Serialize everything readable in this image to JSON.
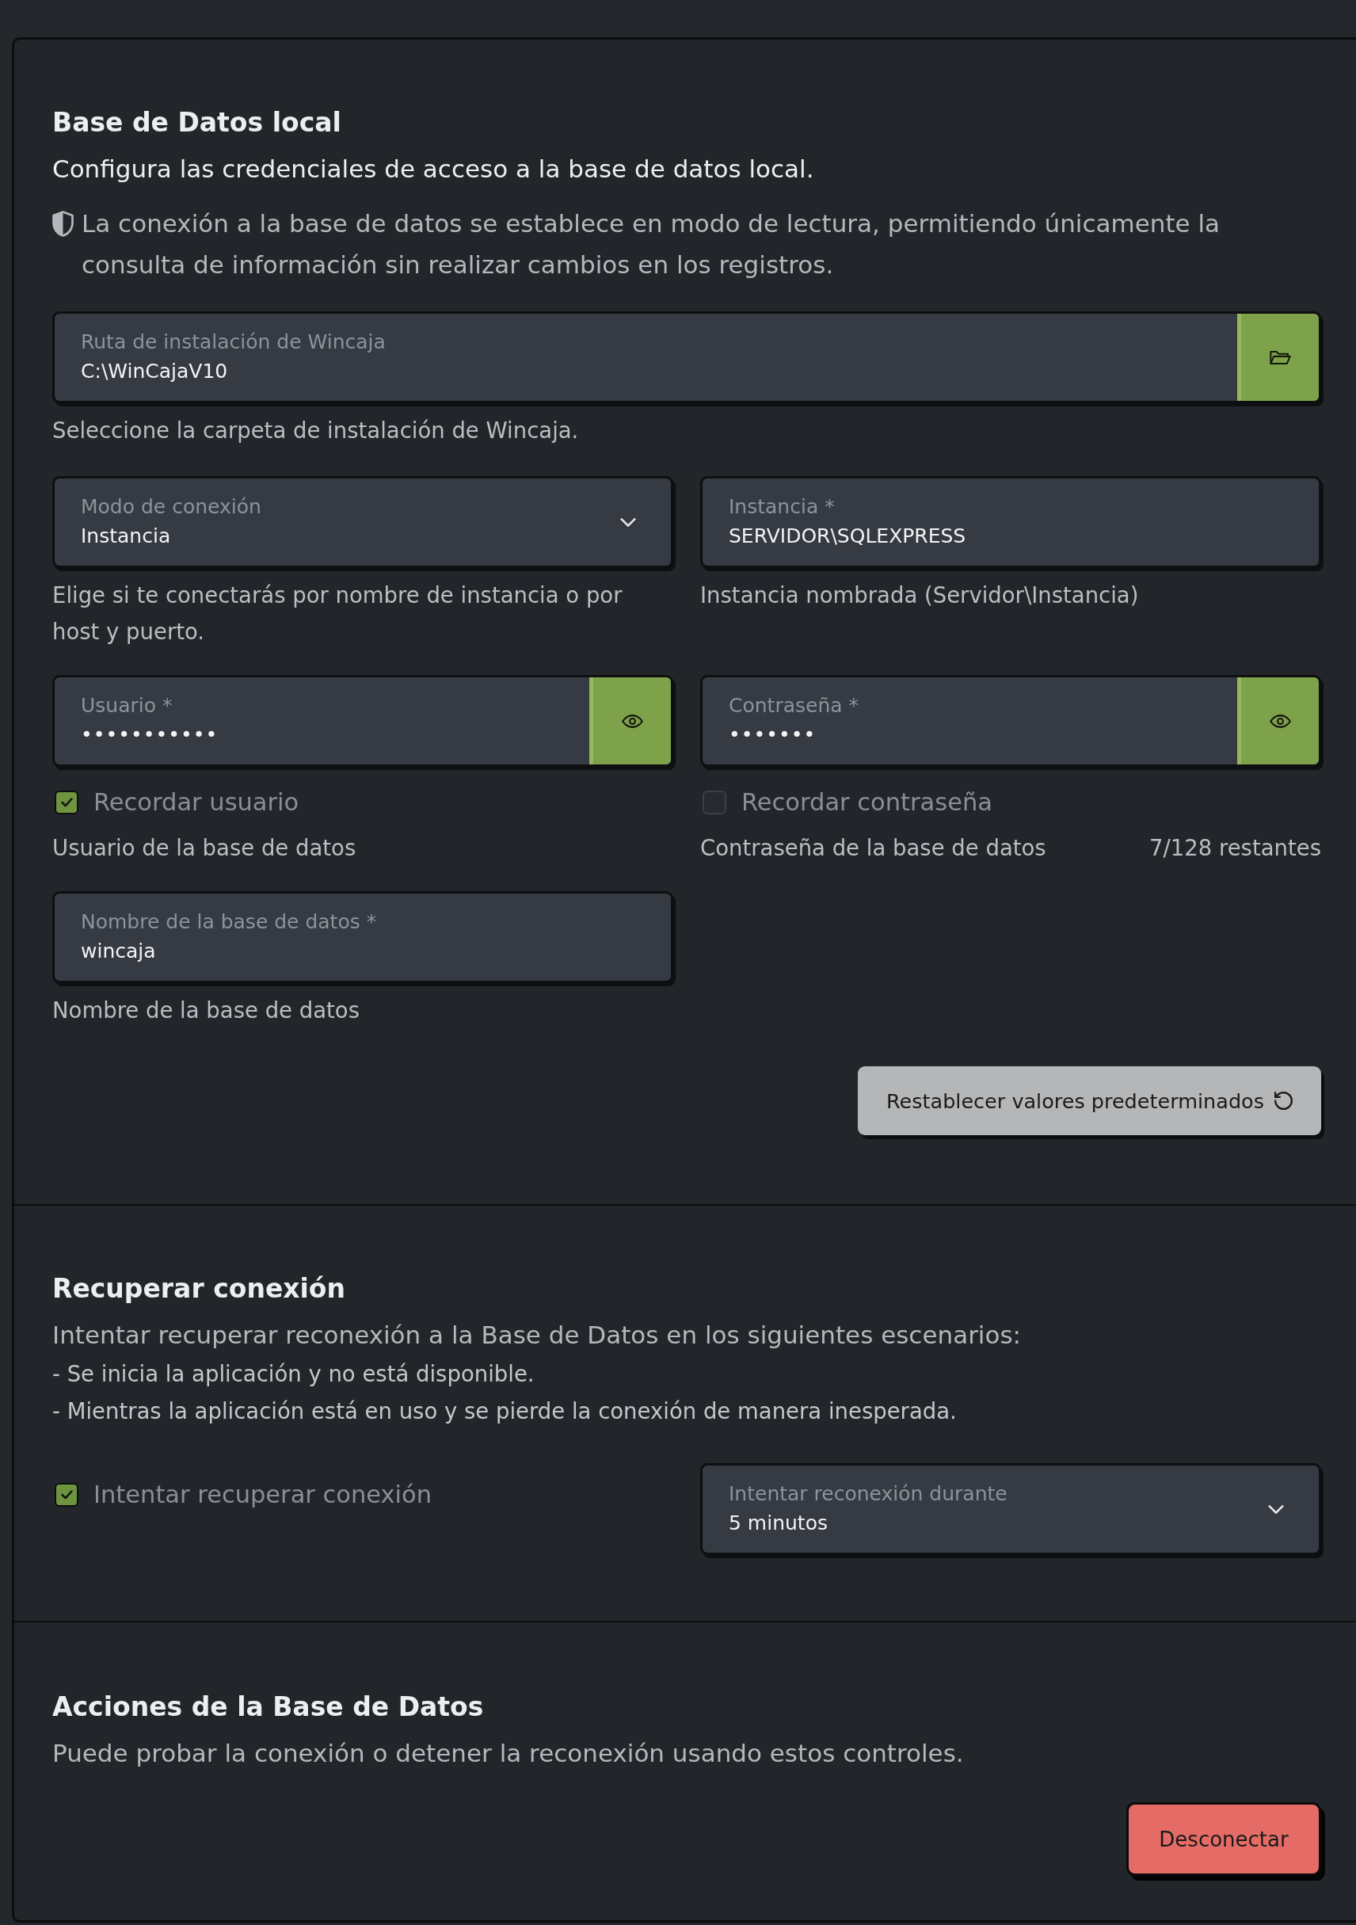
{
  "local_database": {
    "title": "Base de Datos local",
    "subtitle": "Configura las credenciales de acceso a la base de datos local.",
    "note": "La conexión a la base de datos se establece en modo de lectura, permitiendo únicamente la consulta de información sin realizar cambios en los registros.",
    "install_path": {
      "kind": "path",
      "label": "Ruta de instalación de Wincaja",
      "value": "C:\\WinCajaV10",
      "helper": "Seleccione la carpeta de instalación de Wincaja."
    },
    "fields": [
      {
        "kind": "select",
        "label": "Modo de conexión",
        "value": "Instancia",
        "helper": "Elige si te conectarás por nombre de instancia o por host y puerto."
      },
      {
        "kind": "text",
        "label": "Instancia *",
        "value": "SERVIDOR\\SQLEXPRESS",
        "helper": "Instancia nombrada (Servidor\\Instancia)"
      },
      {
        "kind": "secret",
        "label": "Usuario *",
        "value": "•••••••••••",
        "remember": {
          "label": "Recordar usuario",
          "checked": true
        },
        "helper": "Usuario de la base de datos"
      },
      {
        "kind": "secret",
        "label": "Contraseña *",
        "value": "•••••••",
        "remember": {
          "label": "Recordar contraseña",
          "checked": false
        },
        "helper": "Contraseña de la base de datos",
        "counter": "7/128 restantes"
      },
      {
        "kind": "text",
        "label": "Nombre de la base de datos *",
        "value": "wincaja",
        "helper": "Nombre de la base de datos"
      }
    ],
    "reset_button": {
      "kind": "secondary",
      "label": "Restablecer valores predeterminados"
    }
  },
  "reconnection": {
    "title": "Recuperar conexión",
    "description": "Intentar recuperar reconexión a la Base de Datos en los siguientes escenarios:",
    "scenarios": [
      "- Se inicia la aplicación y no está disponible.",
      "- Mientras la aplicación está en uso y se pierde la conexión de manera inesperada."
    ],
    "retry": {
      "label": "Intentar recuperar conexión",
      "checked": true
    },
    "duration": {
      "kind": "select",
      "label": "Intentar reconexión durante",
      "value": "5 minutos"
    }
  },
  "actions": {
    "title": "Acciones de la Base de Datos",
    "description": "Puede probar la conexión o detener la reconexión usando estos controles.",
    "buttons": [
      {
        "kind": "danger",
        "label": "Desconectar"
      }
    ]
  }
}
